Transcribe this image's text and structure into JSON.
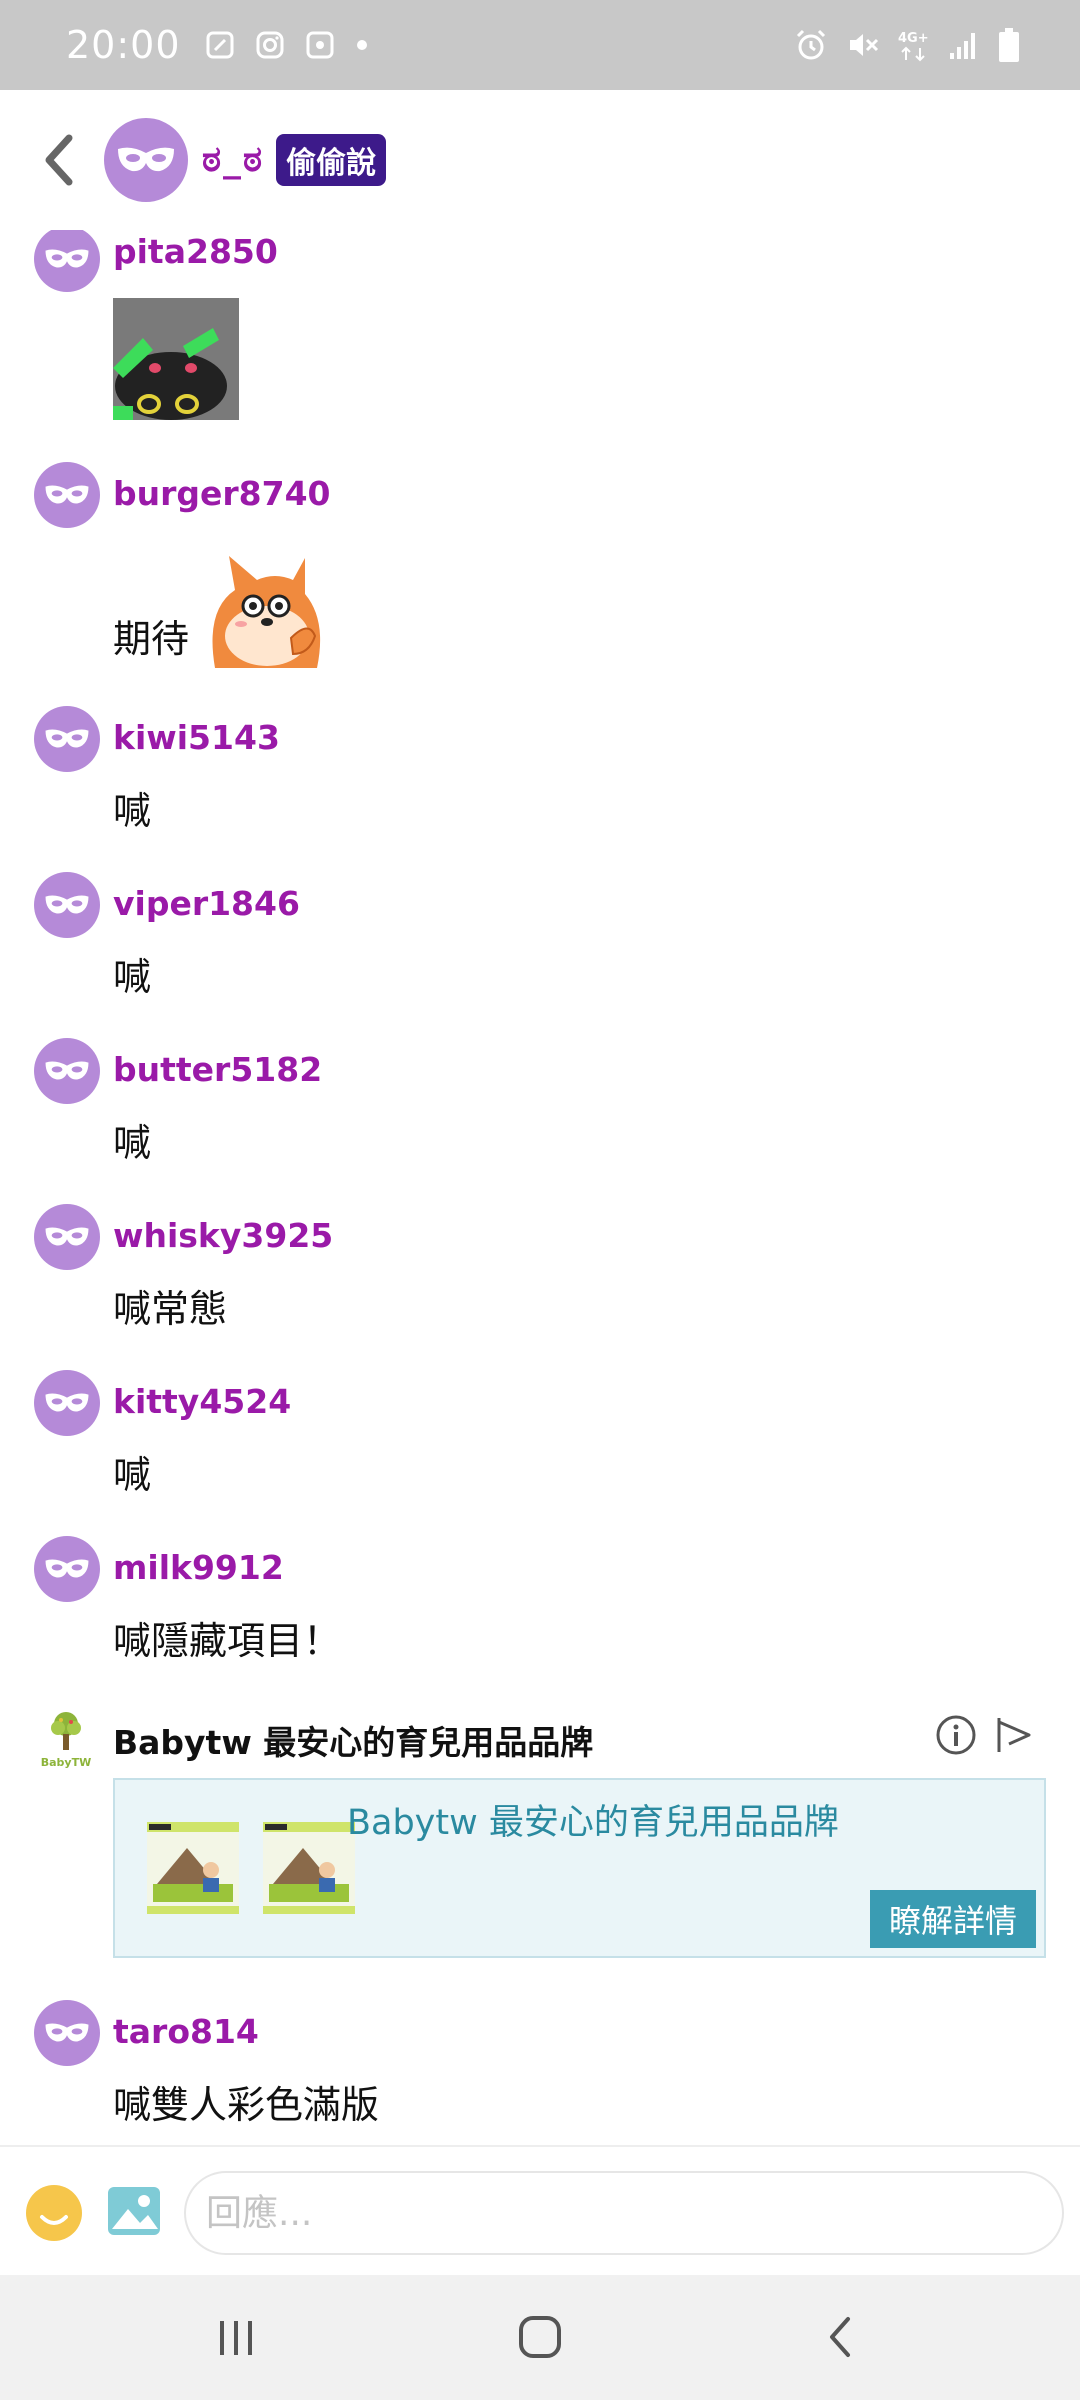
{
  "status_bar": {
    "time": "20:00",
    "left_icons": [
      "notification-icon",
      "instagram-icon",
      "notification-icon",
      "dot-icon"
    ],
    "right_icons": [
      "alarm-icon",
      "mute-icon",
      "4g-icon",
      "signal-icon",
      "battery-icon"
    ],
    "network": "4G+"
  },
  "header": {
    "title": "ಠ_ಠ",
    "badge": "偷偷說"
  },
  "messages": [
    {
      "user": "pita2850",
      "text": "",
      "sticker": "cat-sticker"
    },
    {
      "user": "burger8740",
      "text": "期待",
      "sticker": "fox-sticker"
    },
    {
      "user": "kiwi5143",
      "text": "喊"
    },
    {
      "user": "viper1846",
      "text": "喊"
    },
    {
      "user": "butter5182",
      "text": "喊"
    },
    {
      "user": "whisky3925",
      "text": "喊常態"
    },
    {
      "user": "kitty4524",
      "text": "喊"
    },
    {
      "user": "milk9912",
      "text": "喊隱藏項目！"
    },
    {
      "user": "taro814",
      "text": "喊雙人彩色滿版"
    }
  ],
  "ad": {
    "logo_text": "BabyTW",
    "title": "Babytw 最安心的育兒用品品牌",
    "card_title": "Babytw 最安心的育兒用品品牌",
    "cta": "瞭解詳情"
  },
  "input": {
    "placeholder": "回應..."
  },
  "colors": {
    "username": "#9a1aa8",
    "avatar": "#b58ad8",
    "badge_bg": "#3d1a8a",
    "ad_cta": "#3a9cb3",
    "ad_title": "#2a8aa0",
    "status_bar": "#c8c8c8"
  }
}
